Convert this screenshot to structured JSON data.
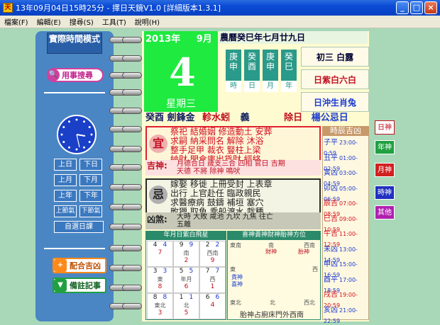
{
  "titlebar": {
    "title": "13年09月04日15時25分 - 擇日天鏡V1.0 [詳細版本1.3.1]"
  },
  "menu": [
    "檔案(F)",
    "編輯(E)",
    "搜尋(S)",
    "工具(T)",
    "說明(H)"
  ],
  "left": {
    "mode_title": "實際時間模式",
    "search_btn": "用事搜尋",
    "nav": {
      "prev_day": "上日",
      "next_day": "下日",
      "prev_month": "上月",
      "next_month": "下月",
      "prev_year": "上年",
      "next_year": "下年",
      "prev_jq": "上節氣",
      "next_jq": "下節氣",
      "custom": "自選日課"
    },
    "match_btn": "配合吉凶",
    "note_btn": "備註記事"
  },
  "date": {
    "year": "2013年",
    "month": "9月",
    "day": "4",
    "weekday": "星期三",
    "lunar": "農曆癸巳年七月廿九日"
  },
  "ganzhi": [
    {
      "top": "庚申",
      "label": "時"
    },
    {
      "top": "癸酉",
      "label": "日"
    },
    {
      "top": "庚申",
      "label": "月"
    },
    {
      "top": "癸巳",
      "label": "年"
    }
  ],
  "info": {
    "jieqi": "初三  白露",
    "star": "日紫白六白",
    "chong": "日沖生肖兔"
  },
  "zodiac_row": {
    "nayin": "癸酉  劍鋒金",
    "xiu": "軫水蚓",
    "jian": "義",
    "chu": "除日",
    "gong": "楊公忌日"
  },
  "yi": {
    "char": "宜",
    "lines": [
      "祭祀  結婚姻  修造動土  安葬",
      "求嗣  納采問名  解除  沐浴",
      "整手足甲  裁衣  豎柱上梁",
      "納財  開倉庫出貨財  經絡"
    ],
    "jishen_label": "吉神:",
    "jishen_lines": [
      "月德合日  歲支三合  四相  官日  吉期",
      "天德  不將  除神  鳴吠"
    ]
  },
  "ji": {
    "char": "忌",
    "lines": [
      "嫁娶  移徙  上冊受封  上表章",
      "出行  上官赴任  臨政親民",
      "求醫療病  鼓鑄  補垣  塞穴",
      "畋獵  取魚  乘船渡水  栽種"
    ],
    "xiongsha_label": "凶煞:",
    "xiongsha_lines": [
      "大時  大敗  咸池  九坎  九焦  往亡",
      "五離"
    ]
  },
  "hours": {
    "title": "時辰吉凶",
    "rows": [
      {
        "name": "子平",
        "time": "23:00-0:59",
        "good": false
      },
      {
        "name": "丑平",
        "time": "01:00-02:59",
        "good": false
      },
      {
        "name": "寅凶",
        "time": "03:00-04:59",
        "good": false
      },
      {
        "name": "卯凶",
        "time": "05:00-06:59",
        "good": false
      },
      {
        "name": "辰吉",
        "time": "07:00-08:59",
        "good": true
      },
      {
        "name": "巳吉",
        "time": "09:00-10:59",
        "good": true
      },
      {
        "name": "午吉",
        "time": "11:00-12:59",
        "good": true
      },
      {
        "name": "未凶",
        "time": "13:00-14:59",
        "good": false
      },
      {
        "name": "申凶",
        "time": "15:00-16:59",
        "good": false
      },
      {
        "name": "酉平",
        "time": "17:00-18:59",
        "good": false
      },
      {
        "name": "戌吉",
        "time": "19:00-20:59",
        "good": true
      },
      {
        "name": "亥凶",
        "time": "21:00-22:59",
        "good": false
      }
    ]
  },
  "side_tabs": [
    "日神",
    "年神",
    "月神",
    "時神",
    "其他"
  ],
  "star_board": {
    "title": "年月日紫白飛星",
    "cells": [
      {
        "tl": "4",
        "tr": "4",
        "c": "",
        "b": "7"
      },
      {
        "tl": "9",
        "tr": "9",
        "c": "南",
        "b": "2"
      },
      {
        "tl": "2",
        "tr": "2",
        "c": "西南",
        "b": "9"
      },
      {
        "tl": "3",
        "tr": "3",
        "c": "東",
        "b": "8"
      },
      {
        "tl": "5",
        "tr": "5",
        "c": "年月",
        "b": "6"
      },
      {
        "tl": "7",
        "tr": "7",
        "c": "西",
        "b": "1"
      },
      {
        "tl": "8",
        "tr": "8",
        "c": "東北",
        "b": "3"
      },
      {
        "tl": "1",
        "tr": "1",
        "c": "北",
        "b": "5"
      },
      {
        "tl": "6",
        "tr": "6",
        "c": "",
        "b": "4"
      }
    ]
  },
  "god_board": {
    "title": "喜神貴神財神胎神方位",
    "labels": {
      "tl": "東南",
      "t": "南",
      "tr": "西南",
      "l": "東",
      "r": "西",
      "bl": "東北",
      "b": "北",
      "br": "西北",
      "caishen": "財神",
      "taishen": "胎神",
      "guishen": "貴神",
      "xishen": "喜神"
    },
    "footer": "胎神占廚床門外西南"
  }
}
